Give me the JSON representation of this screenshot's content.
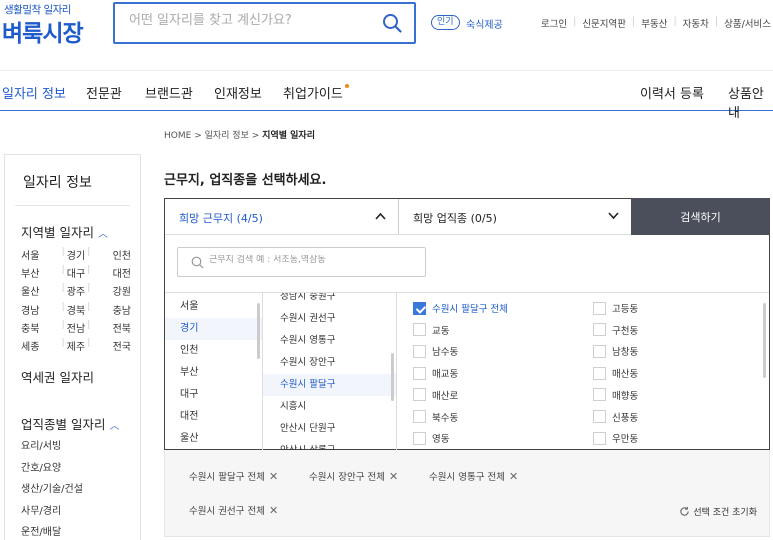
{
  "header": {
    "logo_sub": "생활밀착 일자리",
    "logo_main": "벼룩시장",
    "search_placeholder": "어떤 일자리를 찾고 계신가요?",
    "popular_badge": "인기",
    "popular_text": "숙식제공",
    "util_links": [
      "로그인",
      "신문지역판",
      "부동산",
      "자동차",
      "상품/서비스"
    ]
  },
  "nav": {
    "items": [
      "일자리 정보",
      "전문관",
      "브랜드관",
      "인재정보",
      "취업가이드"
    ],
    "right_items": [
      "이력서 등록",
      "상품안내"
    ]
  },
  "breadcrumb": {
    "home": "HOME",
    "sep1": ">",
    "mid": "일자리 정보",
    "sep2": ">",
    "current": "지역별 일자리"
  },
  "sidebar": {
    "title": "일자리 정보",
    "region_heading": "지역별 일자리",
    "regions": [
      [
        "서울",
        "경기",
        "인천"
      ],
      [
        "부산",
        "대구",
        "대전"
      ],
      [
        "울산",
        "광주",
        "강원"
      ],
      [
        "경남",
        "경북",
        "충남"
      ],
      [
        "충북",
        "전남",
        "전북"
      ],
      [
        "세종",
        "제주",
        "전국"
      ]
    ],
    "station_heading": "역세권 일자리",
    "job_heading": "업직종별 일자리",
    "jobs": [
      "요리/서빙",
      "간호/요양",
      "생산/기술/건설",
      "사무/경리",
      "운전/배달"
    ]
  },
  "main": {
    "title": "근무지, 업직종을 선택하세요.",
    "tab_area": "희망 근무지 (4/5)",
    "tab_job": "희망 업직종 (0/5)",
    "search_button": "검색하기",
    "area_search_placeholder": "근무지 검색 예 : 서초동,역삼동",
    "provinces": [
      "서울",
      "경기",
      "인천",
      "부산",
      "대구",
      "대전",
      "울산"
    ],
    "cities": [
      "성남시 중원구",
      "수원시 권선구",
      "수원시 영통구",
      "수원시 장안구",
      "수원시 팔달구",
      "시흥시",
      "안산시 단원구",
      "안산시 상록구"
    ],
    "dongs_left": [
      "수원시 팔달구 전체",
      "교동",
      "남수동",
      "매교동",
      "매산로",
      "북수동",
      "영동"
    ],
    "dongs_right": [
      "고등동",
      "구천동",
      "남창동",
      "매산동",
      "매향동",
      "신풍동",
      "우만동"
    ]
  },
  "selected": {
    "chips": [
      "수원시 팔달구 전체",
      "수원시 장안구 전체",
      "수원시 영통구 전체",
      "수원시 권선구 전체"
    ],
    "reset_label": "선택 조건 초기화"
  }
}
